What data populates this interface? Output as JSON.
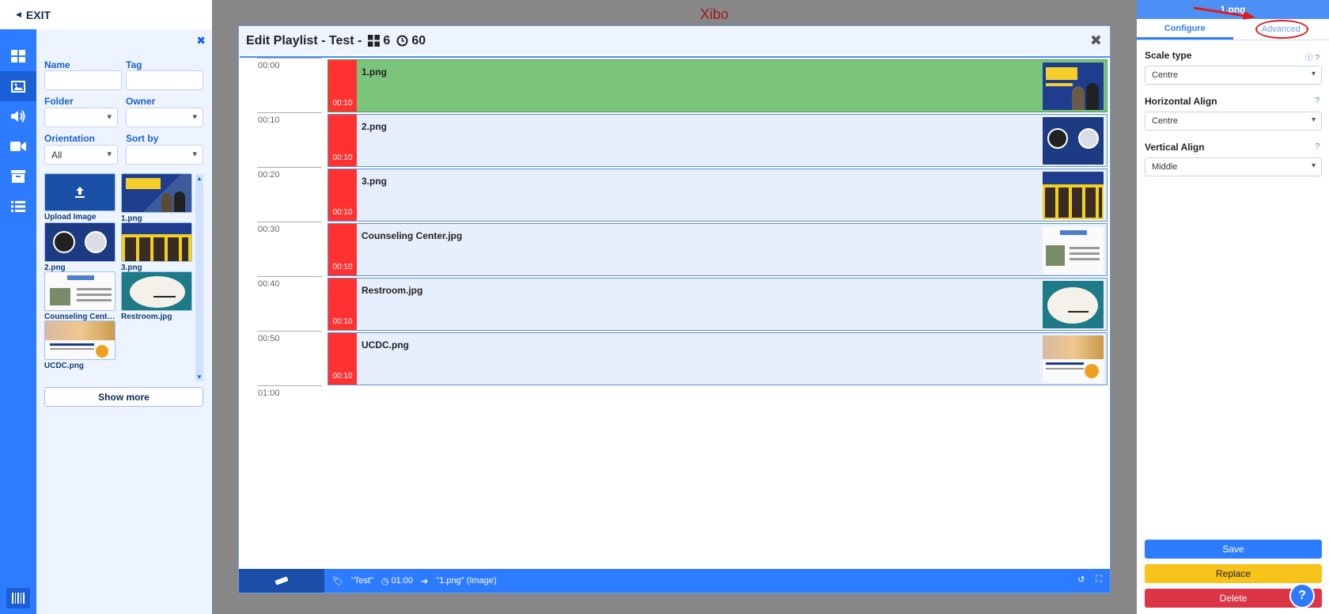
{
  "topbar": {
    "exit_label": "EXIT"
  },
  "library": {
    "labels": {
      "name": "Name",
      "tag": "Tag",
      "folder": "Folder",
      "owner": "Owner",
      "orientation": "Orientation",
      "sort_by": "Sort by"
    },
    "orientation_value": "All",
    "tiles": [
      {
        "label": "Upload Image"
      },
      {
        "label": "1.png"
      },
      {
        "label": "2.png"
      },
      {
        "label": "3.png"
      },
      {
        "label": "Counseling Center..."
      },
      {
        "label": "Restroom.jpg"
      },
      {
        "label": "UCDC.png"
      }
    ],
    "show_more": "Show more"
  },
  "background": {
    "logo": "Xibo"
  },
  "modal": {
    "title": "Edit Playlist - Test -",
    "widget_count": "6",
    "duration": "60",
    "ticks": [
      "00:00",
      "00:10",
      "00:20",
      "00:30",
      "00:40",
      "00:50",
      "01:00"
    ],
    "rows": [
      {
        "name": "1.png",
        "duration": "00:10"
      },
      {
        "name": "2.png",
        "duration": "00:10"
      },
      {
        "name": "3.png",
        "duration": "00:10"
      },
      {
        "name": "Counseling Center.jpg",
        "duration": "00:10"
      },
      {
        "name": "Restroom.jpg",
        "duration": "00:10"
      },
      {
        "name": "UCDC.png",
        "duration": "00:10"
      }
    ],
    "footer": {
      "playlist": "\"Test\"",
      "time": "01:00",
      "selected": "\"1.png\" (Image)"
    }
  },
  "properties": {
    "title": "1.png",
    "tabs": {
      "configure": "Configure",
      "advanced": "Advanced"
    },
    "scale_type": {
      "label": "Scale type",
      "value": "Centre"
    },
    "horizontal_align": {
      "label": "Horizontal Align",
      "value": "Centre"
    },
    "vertical_align": {
      "label": "Vertical Align",
      "value": "Middle"
    },
    "buttons": {
      "save": "Save",
      "replace": "Replace",
      "delete": "Delete"
    }
  },
  "colors": {
    "primary": "#2d7bff",
    "duration_red": "#ff3131",
    "active_green": "#7ac47c",
    "annotation_red": "#e01a1a"
  }
}
